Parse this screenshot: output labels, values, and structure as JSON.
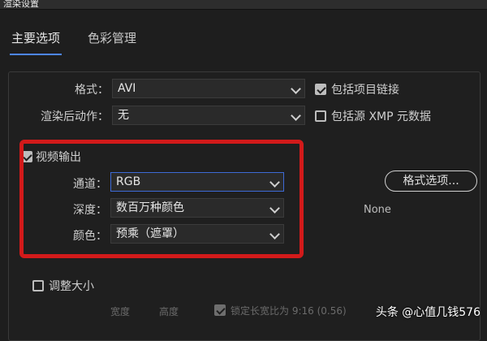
{
  "window": {
    "title": "渲染设置"
  },
  "tabs": [
    {
      "label": "主要选项"
    },
    {
      "label": "色彩管理"
    }
  ],
  "format": {
    "label": "格式：",
    "value": "AVI"
  },
  "post_render": {
    "label": "渲染后动作：",
    "value": "无"
  },
  "include_project_link": {
    "label": "包括项目链接",
    "checked": true
  },
  "include_xmp": {
    "label": "包括源 XMP 元数据",
    "checked": false
  },
  "video_output": {
    "label": "视频输出",
    "checked": true
  },
  "channels": {
    "label": "通道：",
    "value": "RGB"
  },
  "depth": {
    "label": "深度：",
    "value": "数百万种颜色"
  },
  "color": {
    "label": "颜色：",
    "value": "预乘（遮罩）"
  },
  "format_options": {
    "label": "格式选项..."
  },
  "codec_info": {
    "value": "None"
  },
  "resize": {
    "label": "调整大小",
    "checked": false
  },
  "resize_fields": {
    "width": "宽度",
    "height": "高度",
    "lock_aspect": "锁定长宽比为 9:16 (0.56)"
  },
  "watermark": {
    "text": "头条 @心值几钱576"
  }
}
